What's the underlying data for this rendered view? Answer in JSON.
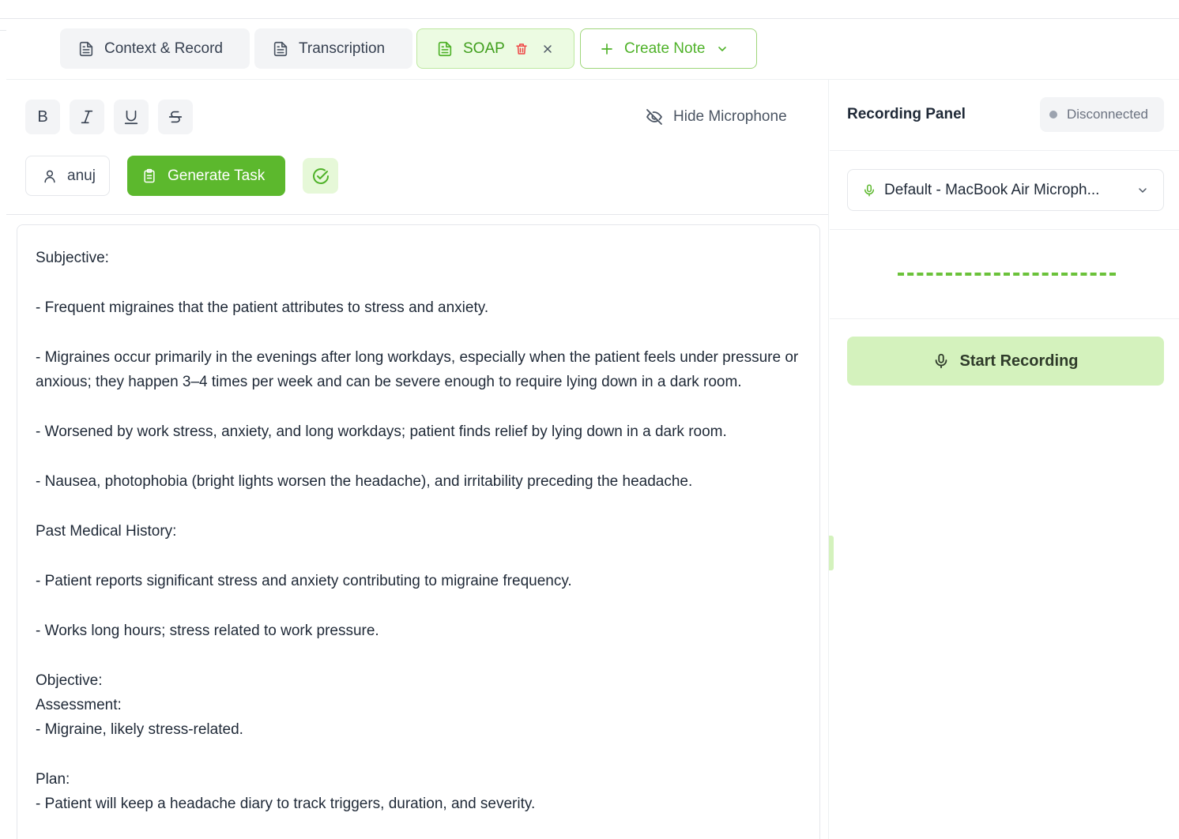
{
  "tabs": {
    "context": "Context & Record",
    "transcription": "Transcription",
    "soap": "SOAP",
    "create_note": "Create Note"
  },
  "toolbar": {
    "bold": "B",
    "hide_microphone": "Hide Microphone",
    "user": "anuj",
    "generate_task": "Generate Task"
  },
  "note": {
    "subjective_heading": "Subjective:",
    "subjective_1": "- Frequent migraines that the patient attributes to stress and anxiety.",
    "subjective_2": "- Migraines occur primarily in the evenings after long workdays, especially when the patient feels under pressure or anxious; they happen 3–4 times per week and can be severe enough to require lying down in a dark room.",
    "subjective_3": "- Worsened by work stress, anxiety, and long workdays; patient finds relief by lying down in a dark room.",
    "subjective_4": "- Nausea, photophobia (bright lights worsen the headache), and irritability preceding the headache.",
    "pmh_heading": "Past Medical History:",
    "pmh_1": "- Patient reports significant stress and anxiety contributing to migraine frequency.",
    "pmh_2": "- Works long hours; stress related to work pressure.",
    "objective_heading": "Objective:",
    "assessment_heading": "Assessment:",
    "assessment_1": "- Migraine, likely stress-related.",
    "plan_heading": "Plan:",
    "plan_1": "- Patient will keep a headache diary to track triggers, duration, and severity."
  },
  "recording_panel": {
    "title": "Recording Panel",
    "status": "Disconnected",
    "microphone": "Default - MacBook Air Microph...",
    "start_label": "Start Recording"
  },
  "colors": {
    "accent": "#5cb82d",
    "accent_light": "#d4f2bd",
    "danger": "#ef4444",
    "status_dot": "#9ca3af"
  },
  "icons": [
    "document-icon",
    "trash-icon",
    "close-icon",
    "plus-icon",
    "chevron-down-icon",
    "italic-icon",
    "underline-icon",
    "strikethrough-icon",
    "eye-off-icon",
    "user-icon",
    "clipboard-icon",
    "check-circle-icon",
    "microphone-icon"
  ]
}
